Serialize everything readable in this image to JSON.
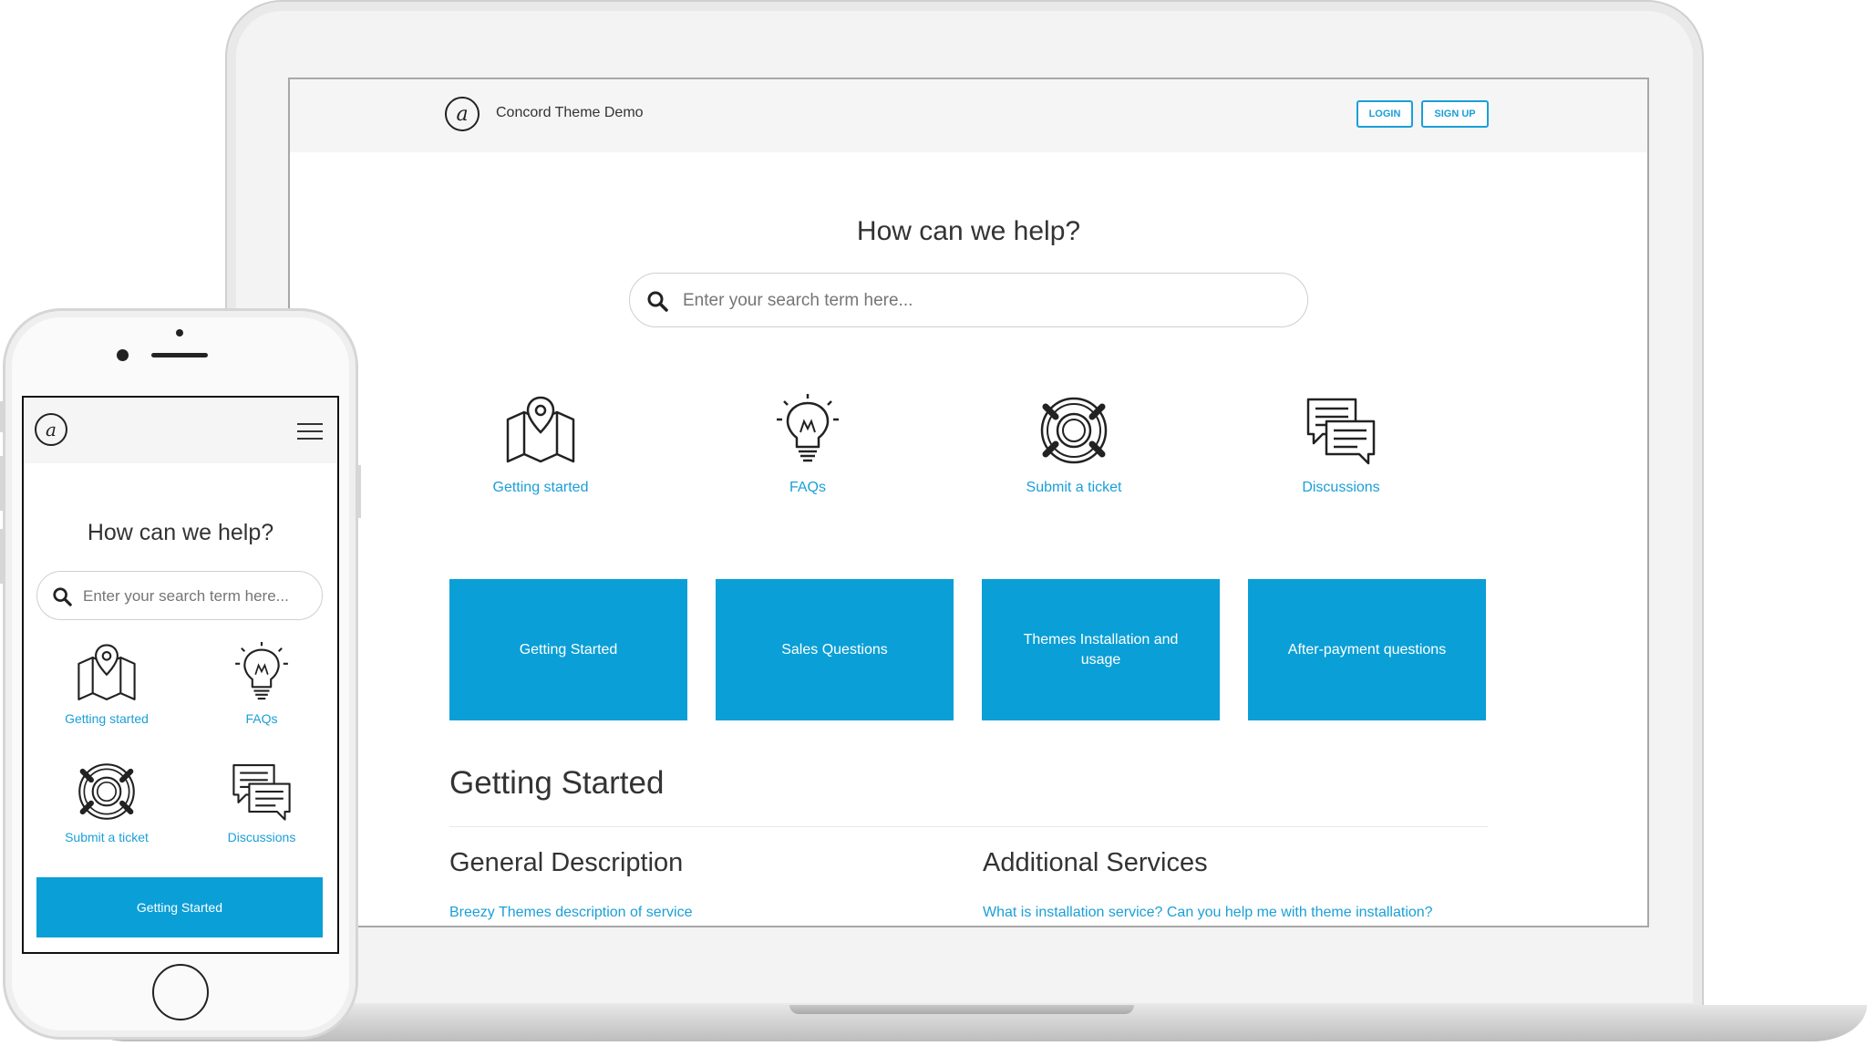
{
  "brand": {
    "logo_glyph": "a",
    "name": "Concord Theme Demo"
  },
  "header": {
    "login_label": "LOGIN",
    "signup_label": "SIGN UP"
  },
  "hero": {
    "title": "How can we help?"
  },
  "search": {
    "placeholder": "Enter your search term here..."
  },
  "categories": [
    {
      "label": "Getting started",
      "icon": "map-pin-icon"
    },
    {
      "label": "FAQs",
      "icon": "lightbulb-icon"
    },
    {
      "label": "Submit a ticket",
      "icon": "lifebuoy-icon"
    },
    {
      "label": "Discussions",
      "icon": "chat-bubbles-icon"
    }
  ],
  "tiles": [
    {
      "label": "Getting Started"
    },
    {
      "label": "Sales Questions"
    },
    {
      "label": "Themes Installation and usage"
    },
    {
      "label": "After-payment questions"
    }
  ],
  "section": {
    "title": "Getting Started",
    "columns": [
      {
        "heading": "General Description",
        "link": "Breezy Themes description of service"
      },
      {
        "heading": "Additional Services",
        "link": "What is installation service? Can you help me with theme installation?"
      }
    ]
  },
  "colors": {
    "accent": "#1a9fd8",
    "tile": "#0a9fd6",
    "header_bg": "#f5f5f5"
  }
}
